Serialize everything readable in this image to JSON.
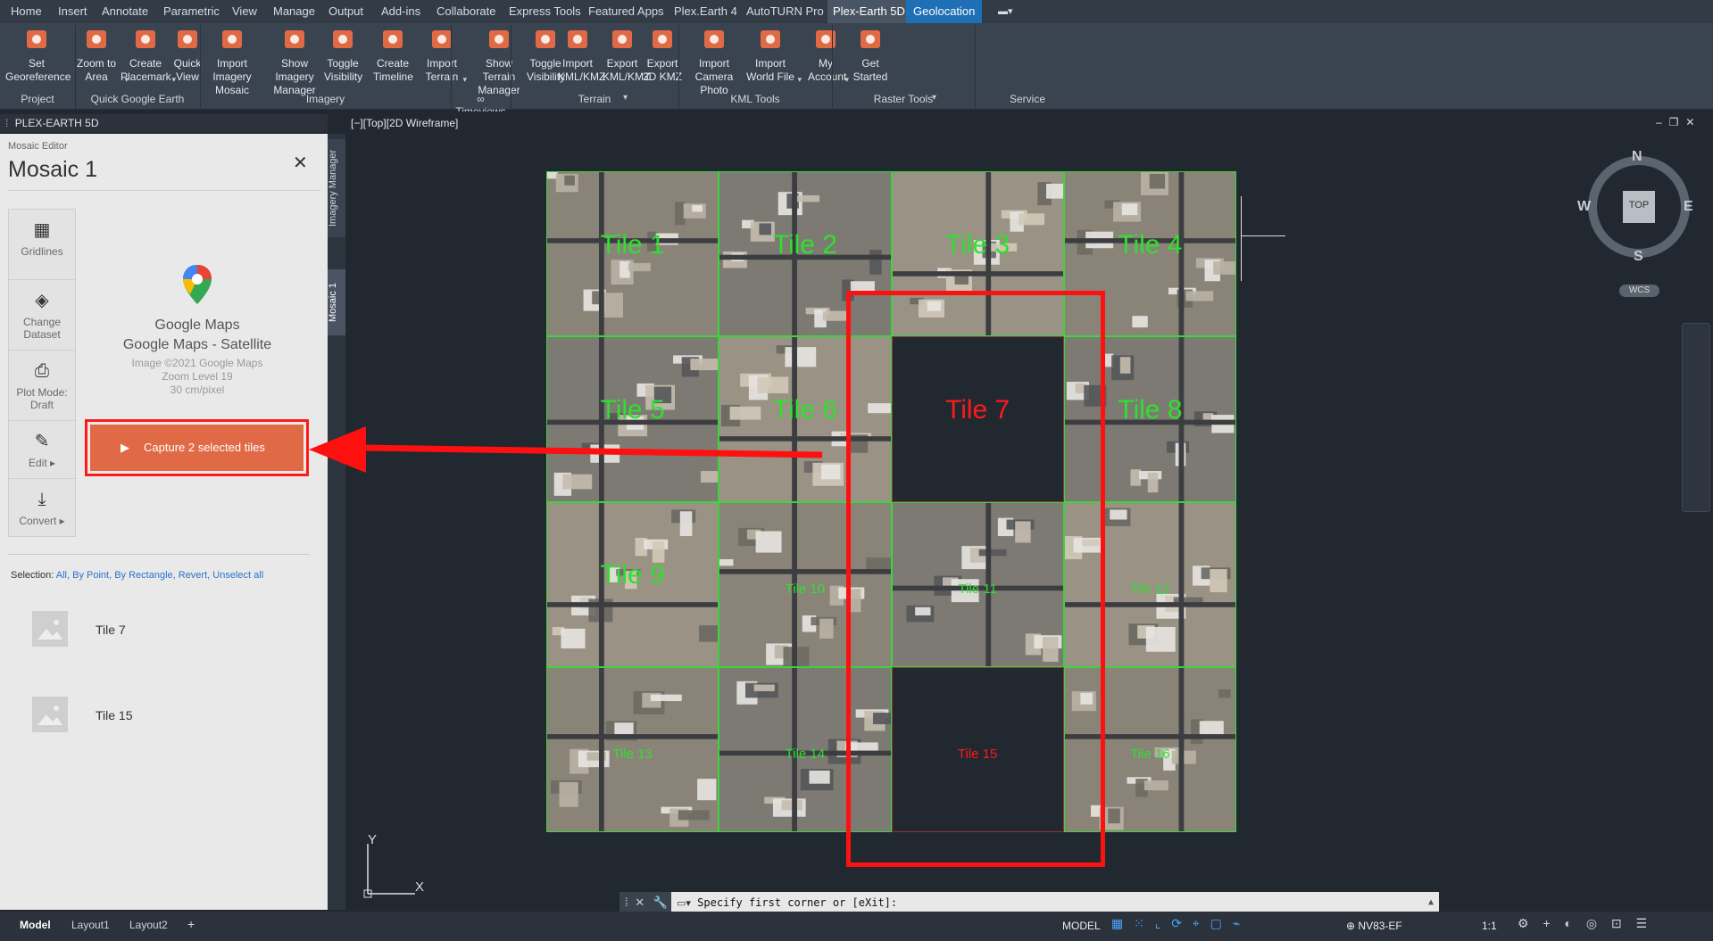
{
  "ribbon_tabs": [
    "Home",
    "Insert",
    "Annotate",
    "Parametric",
    "View",
    "Manage",
    "Output",
    "Add-ins",
    "Collaborate",
    "Express Tools",
    "Featured Apps",
    "Plex.Earth 4",
    "AutoTURN Pro",
    "Plex-Earth 5D",
    "Geolocation"
  ],
  "ribbon": {
    "buttons": [
      {
        "l1": "Set",
        "l2": "Georeference",
        "icon": "georeference-icon"
      },
      {
        "l1": "Zoom to",
        "l2": "Area",
        "icon": "zoom-to-area-icon"
      },
      {
        "l1": "Create",
        "l2": "Placemark",
        "icon": "placemark-icon"
      },
      {
        "l1": "Quick",
        "l2": "View",
        "icon": "quick-view-icon"
      },
      {
        "l1": "Import Imagery",
        "l2": "Mosaic",
        "icon": "mosaic-icon"
      },
      {
        "l1": "Show Imagery",
        "l2": "Manager",
        "icon": "imagery-manager-icon"
      },
      {
        "l1": "Toggle",
        "l2": "Visibility",
        "icon": "toggle-visibility-icon"
      },
      {
        "l1": "Create",
        "l2": "Timeline",
        "icon": "timeline-icon"
      },
      {
        "l1": "Import",
        "l2": "Terrain",
        "icon": "import-terrain-icon"
      },
      {
        "l1": "Show Terrain",
        "l2": "Manager",
        "icon": "terrain-manager-icon"
      },
      {
        "l1": "Toggle",
        "l2": "Visibility",
        "icon": "terrain-visibility-icon"
      },
      {
        "l1": "Import",
        "l2": "KML/KMZ",
        "icon": "import-kml-icon"
      },
      {
        "l1": "Export",
        "l2": "KML/KMZ",
        "icon": "export-kml-icon"
      },
      {
        "l1": "Export",
        "l2": "3D KMZ",
        "icon": "export-3d-kmz-icon"
      },
      {
        "l1": "Import",
        "l2": "Camera Photo",
        "icon": "camera-photo-icon"
      },
      {
        "l1": "Import",
        "l2": "World File",
        "icon": "world-file-icon"
      },
      {
        "l1": "My",
        "l2": "Account",
        "icon": "account-icon"
      },
      {
        "l1": "Get",
        "l2": "Started",
        "icon": "get-started-icon"
      }
    ],
    "panels": [
      "Project",
      "Quick Google Earth",
      "Imagery",
      "∞ Timeviews",
      "Terrain",
      "KML Tools",
      "Raster Tools",
      "Service"
    ]
  },
  "palette_title": "PLEX-EARTH 5D",
  "vertical_tabs": [
    "Imagery Manager",
    "Mosaic 1"
  ],
  "editor": {
    "small_title": "Mosaic Editor",
    "title": "Mosaic 1",
    "side_buttons": [
      {
        "label": "Gridlines",
        "icon": "gridlines-icon"
      },
      {
        "label": "Change Dataset",
        "icon": "layers-icon"
      },
      {
        "label": "Plot Mode: Draft",
        "icon": "printer-icon"
      },
      {
        "label": "Edit ▸",
        "icon": "edit-pencil-icon"
      },
      {
        "label": "Convert ▸",
        "icon": "download-icon"
      }
    ],
    "provider": "Google Maps",
    "dataset": "Google Maps - Satellite",
    "copyright": "Image ©2021 Google Maps",
    "zoom": "Zoom Level 19",
    "resolution": "30 cm/pixel",
    "capture_button": "Capture 2 selected tiles",
    "selection_label": "Selection:",
    "selection_links": [
      "All,",
      "By Point,",
      "By Rectangle,",
      "Revert,",
      "Unselect all"
    ],
    "selected_tiles": [
      "Tile 7",
      "Tile 15"
    ]
  },
  "viewport_label": "[−][Top][2D Wireframe]",
  "tiles": [
    {
      "label": "Tile 1",
      "selected": false,
      "big": true
    },
    {
      "label": "Tile 2",
      "selected": false,
      "big": true
    },
    {
      "label": "Tile 3",
      "selected": false,
      "big": true
    },
    {
      "label": "Tile 4",
      "selected": false,
      "big": true
    },
    {
      "label": "Tile 5",
      "selected": false,
      "big": true
    },
    {
      "label": "Tile 6",
      "selected": false,
      "big": true
    },
    {
      "label": "Tile 7",
      "selected": true,
      "big": true
    },
    {
      "label": "Tile 8",
      "selected": false,
      "big": true
    },
    {
      "label": "Tile 9",
      "selected": false,
      "big": true
    },
    {
      "label": "Tile 10",
      "selected": false,
      "big": false
    },
    {
      "label": "Tile 11",
      "selected": false,
      "big": false
    },
    {
      "label": "Tile 12",
      "selected": false,
      "big": false
    },
    {
      "label": "Tile 13",
      "selected": false,
      "big": false
    },
    {
      "label": "Tile 14",
      "selected": false,
      "big": false
    },
    {
      "label": "Tile 15",
      "selected": true,
      "big": false
    },
    {
      "label": "Tile 16",
      "selected": false,
      "big": false
    }
  ],
  "viewcube": {
    "n": "N",
    "s": "S",
    "e": "E",
    "w": "W",
    "top": "TOP",
    "wcs": "WCS"
  },
  "ucs": {
    "x": "X",
    "y": "Y"
  },
  "command_prompt": "Specify first corner or [eXit]:",
  "layout_tabs": [
    "Model",
    "Layout1",
    "Layout2",
    "+"
  ],
  "status": {
    "model": "MODEL",
    "crs": "NV83-EF",
    "scale": "1:1"
  },
  "colors": {
    "accent": "#e06a45",
    "highlight": "#ff0000",
    "grid": "#3ad63a",
    "geoloc": "#1e6fb5"
  }
}
